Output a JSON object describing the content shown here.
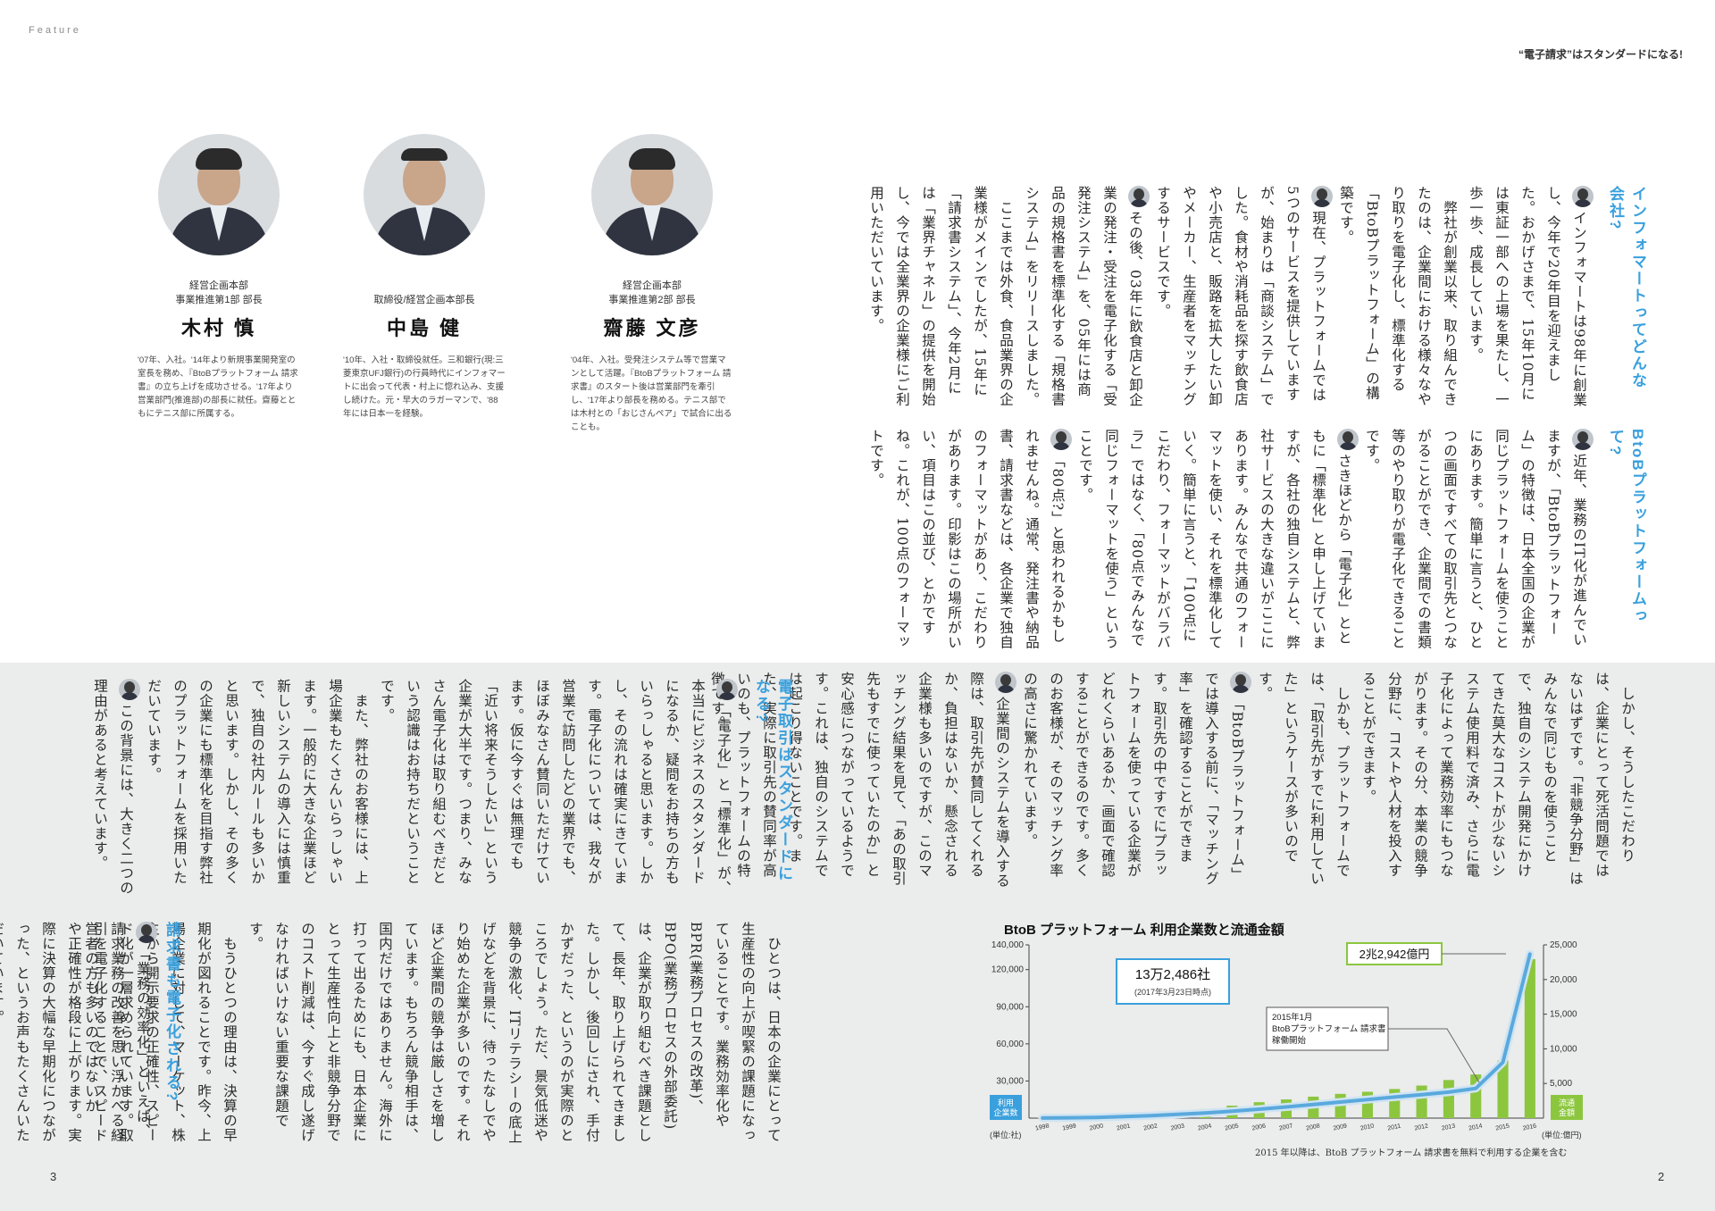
{
  "header": {
    "feature_label": "Feature",
    "running_title": "“電子請求”はスタンダードになる!",
    "page_left": "3",
    "page_right": "2"
  },
  "profiles": [
    {
      "role": "経営企画本部\n事業推進第1部 部長",
      "name": "木村 慎",
      "bio": "'07年、入社。'14年より新規事業開発室の室長を務め、『BtoBプラットフォーム 請求書』の立ち上げを成功させる。'17年より営業部門(推進部)の部長に就任。齋藤とともにテニス部に所属する。"
    },
    {
      "role": "取締役/経営企画本部長",
      "name": "中島 健",
      "bio": "'10年、入社・取締役就任。三和銀行(現:三菱東京UFJ銀行)の行員時代にインフォマートに出会って代表・村上に惚れ込み、支援し続けた。元・早大のラガーマンで、'88年には日本一を経験。"
    },
    {
      "role": "経営企画本部\n事業推進第2部 部長",
      "name": "齋藤 文彦",
      "bio": "'04年、入社。受発注システム等で営業マンとして活躍。『BtoBプラットフォーム 請求書』のスタート後は営業部門を牽引し、'17年より部長を務める。テニス部では木村との「おじさんペア」で試合に出ることも。"
    }
  ],
  "section1": {
    "heading": "インフォマートってどんな会社?",
    "paragraphs": [
      "インフォマートは98年に創業し、今年で20年目を迎えました。おかげさまで、15年10月には東証一部への上場を果たし、一歩一歩、成長しています。",
      "弊社が創業以来、取り組んできたのは、企業間における様々なやり取りを電子化し、標準化する「BtoBプラットフォーム」の構築です。",
      "現在、プラットフォームでは5つのサービスを提供していますが、始まりは「商談システム」でした。食材や消耗品を探す飲食店や小売店と、販路を拡大したい卸やメーカー、生産者をマッチングするサービスです。",
      "その後、03年に飲食店と卸企業の発注・受注を電子化する「受発注システム」を、05年には商品の規格書を標準化する「規格書システム」をリリースしました。",
      "ここまでは外食、食品業界の企業様がメインでしたが、15年に「請求書システム」、今年2月には「業界チャネル」の提供を開始し、今では全業界の企業様にご利用いただいています。"
    ]
  },
  "section2": {
    "heading": "BtoBプラットフォームって?",
    "paragraphs": [
      "近年、業務のIT化が進んでいますが、「BtoBプラットフォーム」の特徴は、日本全国の企業が同じプラットフォームを使うことにあります。簡単に言うと、ひとつの画面ですべての取引先とつながることができ、企業間での書類等のやり取りが電子化できることです。",
      "さきほどから「電子化」とともに「標準化」と申し上げていますが、各社の独自システムと、弊社サービスの大きな違いがここにあります。みんなで共通のフォーマットを使い、それを標準化していく。簡単に言うと、「100点にこだわり、フォーマットがバラバラ」ではなく、「80点でみんなで同じフォーマットを使う」ということです。",
      "「80点?」と思われるかもしれませんね。通常、発注書や納品書、請求書などは、各企業で独自のフォーマットがあり、こだわりがあります。印影はこの場所がいい、項目はこの並び、とかですね。これが、100点のフォーマットです。",
      "しかし、そうしたこだわりは、企業にとって死活問題ではないはずです。「非競争分野」はみんなで同じものを使うことで、独自のシステム開発にかけてきた莫大なコストが少ないシステム使用料で済み、さらに電子化によって業務効率にもつながります。その分、本業の競争分野に、コストや人材を投入することができます。",
      "しかも、プラットフォームでは、「取引先がすでに利用していた」というケースが多いのです。",
      "「BtoBプラットフォーム」では導入する前に、「マッチング率」を確認することができます。取引先の中ですでにプラットフォームを使っている企業がどれくらいあるか、画面で確認することができるのです。多くのお客様が、そのマッチング率の高さに驚かれています。",
      "企業間のシステムを導入する際は、取引先が賛同してくれるか、負担はないか、懸念される企業様も多いのですが、このマッチング結果を見て、「あの取引先もすでに使っていたのか」と安心感につながっているようです。これは、独自のシステムでは起こり得ないことです。また、実際に取引先の賛同率が高いのも、プラットフォームの特徴です。"
    ]
  },
  "section3": {
    "heading": "電子取引はスタンダードになる?",
    "paragraphs": [
      "「電子化」と「標準化」が、本当にビジネスのスタンダードになるか、疑問をお持ちの方もいらっしゃると思います。しかし、その流れは確実にきています。電子化については、我々が営業で訪問したどの業界でも、ほぼみなさん賛同いただけています。仮に今すぐは無理でも「近い将来そうしたい」という企業が大半です。つまり、みなさん電子化は取り組むべきだという認識はお持ちだということです。",
      "また、弊社のお客様には、上場企業もたくさんいらっしゃいます。一般的に大きな企業ほど新しいシステムの導入には慎重で、独自の社内ルールも多いかと思います。しかし、その多くの企業にも標準化を目指す弊社のプラットフォームを採用いただいています。",
      "この背景には、大きく二つの理由があると考えています。",
      "ひとつは、日本の企業にとって生産性の向上が喫緊の課題になっていることです。業務効率化やBPR(業務プロセスの改革)、BPO(業務プロセスの外部委託)は、企業が取り組むべき課題として、長年、取り上げられてきました。しかし、後回しにされ、手付かずだった、というのが実際のところでしょう。ただ、景気低迷や競争の激化、ITリテラシーの底上げなどを背景に、待ったなしでやり始めた企業が多いのです。それほど企業間の競争は厳しさを増しています。もちろん競争相手は、国内だけではありません。海外に打って出るためにも、日本企業にとって生産性向上と非競争分野でのコスト削減は、今すぐ成し遂げなければいけない重要な課題です。",
      "もうひとつの理由は、決算の早期化が図れることです。昨今、上場企業に対して、マーケット、株主から開示要求の正確性、スピード化が一層求められています。取引を電子化することで、スピードや正確性が格段に上がります。実際に決算の大幅な早期化につながった、というお声もたくさんいただいています。"
    ]
  },
  "section4": {
    "heading": "請求書も電子化される?",
    "paragraphs": [
      "「業務の効率化」といえば、請求業務の改善を思い浮かべる経営者の方も多いのではないか"
    ]
  },
  "chart_data": {
    "type": "bar+line",
    "title": "BtoB プラットフォーム 利用企業数と流通金額",
    "categories": [
      "1998",
      "1999",
      "2000",
      "2001",
      "2002",
      "2003",
      "2004",
      "2005",
      "2006",
      "2007",
      "2008",
      "2009",
      "2010",
      "2011",
      "2012",
      "2013",
      "2014",
      "2015",
      "2016"
    ],
    "series": [
      {
        "name": "利用企業数",
        "axis": "left",
        "unit": "社",
        "kind": "line",
        "color": "#5aa9dd",
        "values": [
          100,
          300,
          600,
          1200,
          2000,
          3000,
          4200,
          5600,
          7200,
          9000,
          11000,
          13000,
          15000,
          17000,
          19000,
          21000,
          24000,
          45000,
          132486
        ]
      },
      {
        "name": "流通金額",
        "axis": "right",
        "unit": "億円",
        "kind": "bar",
        "color": "#8cc63f",
        "values": [
          50,
          120,
          250,
          400,
          600,
          900,
          1300,
          1800,
          2300,
          2700,
          3100,
          3500,
          3800,
          4200,
          4700,
          5500,
          6300,
          8300,
          22942
        ]
      }
    ],
    "left_axis": {
      "ticks": [
        "30,000",
        "60,000",
        "90,000",
        "120,000",
        "140,000"
      ],
      "ylim": [
        0,
        140000
      ],
      "badge": "利用\n企業数",
      "unit_label": "(単位:社)"
    },
    "right_axis": {
      "ticks": [
        "5,000",
        "10,000",
        "15,000",
        "20,000",
        "25,000"
      ],
      "ylim": [
        0,
        25000
      ],
      "badge": "流通\n金額",
      "unit_label": "(単位:億円)"
    },
    "annotations": {
      "companies_value": "13万2,486社",
      "companies_date": "(2017年3月23日時点)",
      "amount_value": "2兆2,942億円",
      "launch": "2015年1月\nBtoBプラットフォーム 請求書\n稼働開始"
    },
    "footnote": "2015 年以降は、BtoB プラットフォーム 請求書を無料で利用する企業を含む",
    "colors": {
      "accent_blue": "#3aa0dd",
      "bar_green": "#8cc63f",
      "badge_blue": "#3aa0dd",
      "badge_green": "#8cc63f"
    }
  }
}
